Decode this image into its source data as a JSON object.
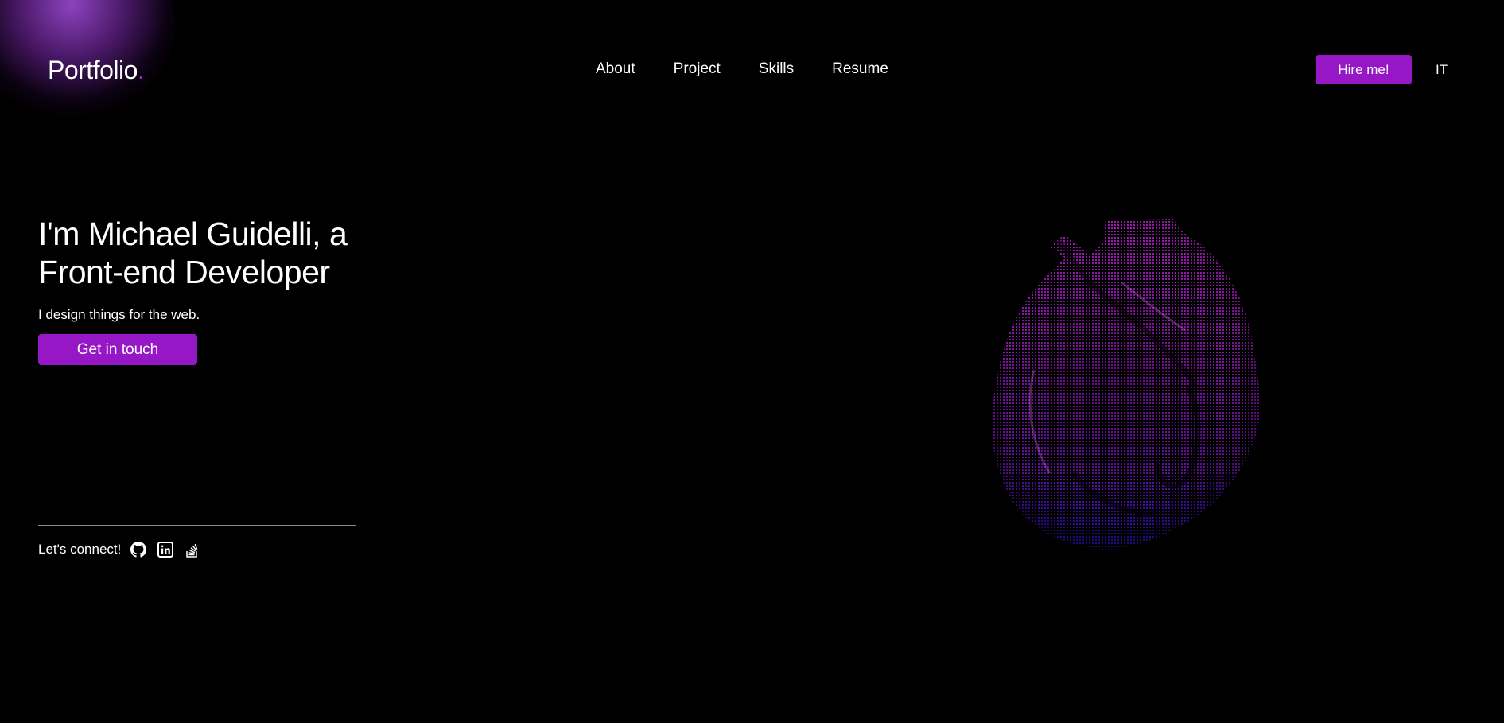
{
  "logo": {
    "text": "Portfolio",
    "dot": "."
  },
  "nav": [
    {
      "label": "About"
    },
    {
      "label": "Project"
    },
    {
      "label": "Skills"
    },
    {
      "label": "Resume"
    }
  ],
  "header": {
    "hire_label": "Hire me!",
    "lang_label": "IT"
  },
  "hero": {
    "title_line1": "I'm Michael Guidelli, a",
    "title_line2": "Front-end Developer",
    "subtitle": "I design things for the web.",
    "cta_label": "Get in touch"
  },
  "connect": {
    "label": "Let's connect!",
    "icons": [
      "github-icon",
      "linkedin-icon",
      "stackoverflow-icon"
    ]
  },
  "colors": {
    "accent": "#9617c6",
    "background": "#000000",
    "text": "#ffffff",
    "orb_top": "#c020e0",
    "orb_bottom": "#2a10e0"
  }
}
